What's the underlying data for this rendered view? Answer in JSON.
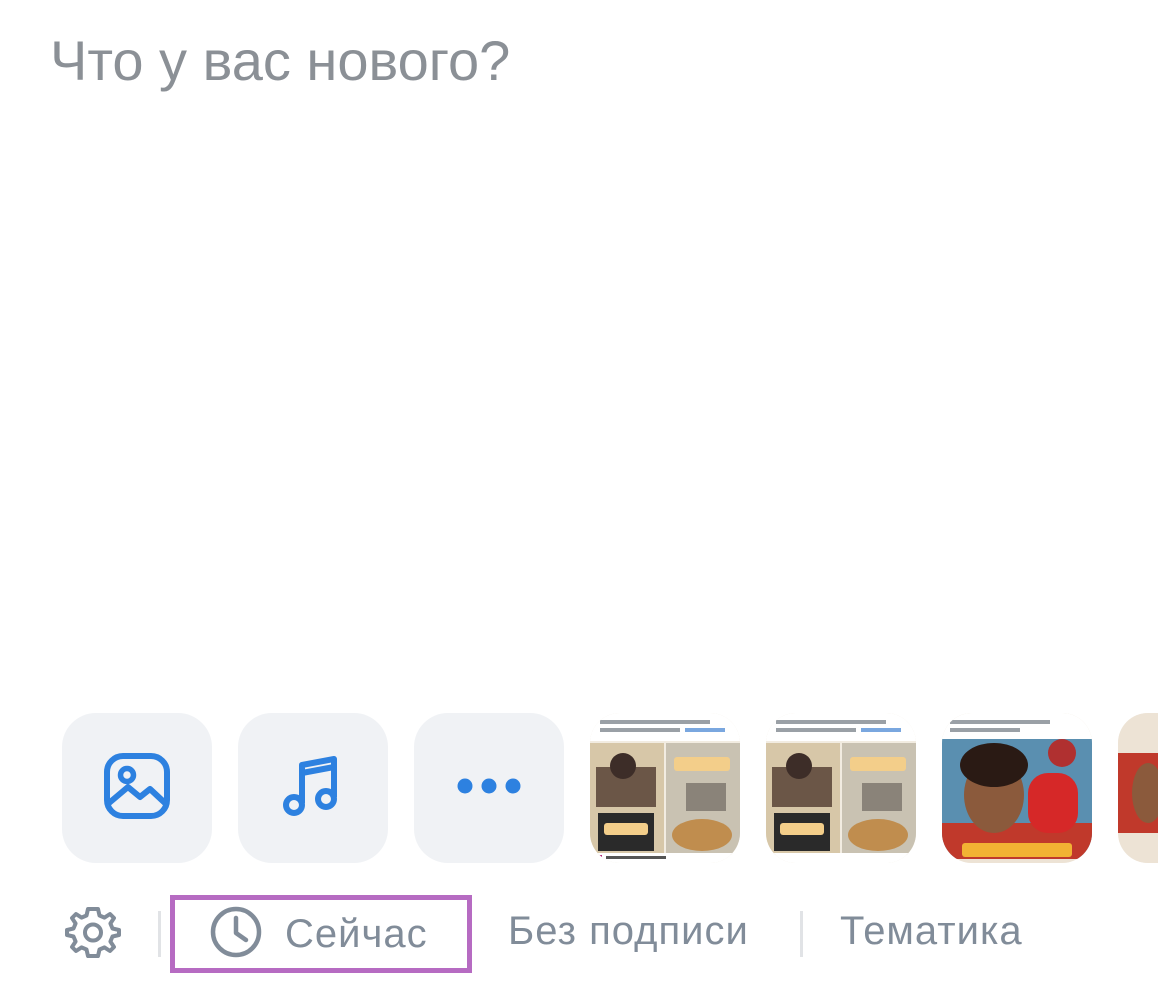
{
  "composer": {
    "placeholder": "Что у вас нового?",
    "value": ""
  },
  "attachments": {
    "photo_icon": "image-icon",
    "music_icon": "music-note-icon",
    "more_icon": "more-dots-icon",
    "accent_color": "#2d81e0",
    "button_bg": "#f0f2f5"
  },
  "footer": {
    "settings_icon": "gear-icon",
    "time_icon": "clock-icon",
    "time_label": "Сейчас",
    "caption_label": "Без подписи",
    "topic_label": "Тематика",
    "highlight_color": "#b66bc2",
    "text_color": "#818c99"
  }
}
